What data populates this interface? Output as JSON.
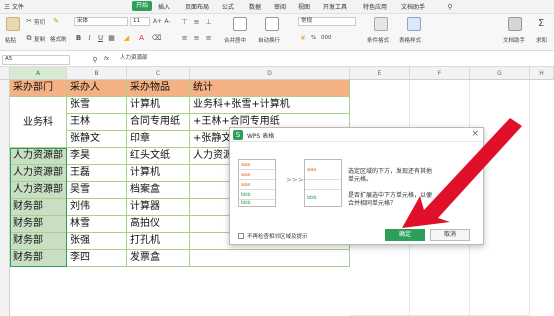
{
  "menubar": {
    "items": [
      "三 文件",
      "开始",
      "插入",
      "页面布局",
      "公式",
      "数据",
      "审阅",
      "视图",
      "开发工具",
      "特色应用",
      "文档助手"
    ],
    "active": "开始"
  },
  "ribbon": {
    "paste": "粘贴",
    "cut": "剪切",
    "copy": "复制",
    "format_painter": "格式刷",
    "font_name": "宋体",
    "font_size": "11",
    "merge_center": "合并居中",
    "wrap": "自动换行",
    "number_format": "常规",
    "conditional": "条件格式",
    "table_style": "表格样式",
    "doc_assistant": "文档助手",
    "sum": "求和",
    "filter": "筛选",
    "percent": "%",
    "thousands": "000"
  },
  "formula_bar": {
    "cell_ref": "A5",
    "fx": "fx",
    "value": "人力资源部"
  },
  "columns": [
    "A",
    "B",
    "C",
    "D",
    "E",
    "F",
    "G",
    "H"
  ],
  "table": {
    "headers": [
      "采办部门",
      "采办人",
      "采办物品",
      "统计"
    ],
    "rows": [
      [
        "业务科",
        "张雪",
        "计算机",
        "业务科+张雪+计算机"
      ],
      [
        "",
        "王林",
        "合同专用纸",
        "+王林+合同专用纸"
      ],
      [
        "",
        "张静文",
        "印章",
        "+张静文+印章"
      ],
      [
        "人力资源部",
        "李昊",
        "红头文纸",
        "人力资源部+李昊+红头文纸"
      ],
      [
        "人力资源部",
        "王磊",
        "计算机",
        ""
      ],
      [
        "人力资源部",
        "吴雪",
        "档案盒",
        ""
      ],
      [
        "财务部",
        "刘伟",
        "计算器",
        ""
      ],
      [
        "财务部",
        "林雪",
        "高拍仪",
        ""
      ],
      [
        "财务部",
        "张强",
        "打孔机",
        ""
      ],
      [
        "财务部",
        "李四",
        "发票盒",
        ""
      ]
    ]
  },
  "dialog": {
    "title": "WPS 表格",
    "message1": "选定区域的下方，发现还有其他单元格。",
    "message2": "是否扩展选中下方单元格，以便合并相同单元格？",
    "checkbox_label": "不再检查相邻区域及提示",
    "ok": "确定",
    "cancel": "取消",
    "mini_left": [
      "aaa",
      "aaa",
      "aaa",
      "bbb",
      "bbb"
    ],
    "mini_right": [
      "aaa",
      "",
      "",
      "bbb",
      ""
    ],
    "arrows": ">>>"
  },
  "colors": {
    "accent": "#2e9e5b",
    "header_fill": "#f4b183",
    "arrow": "#e0102a"
  }
}
